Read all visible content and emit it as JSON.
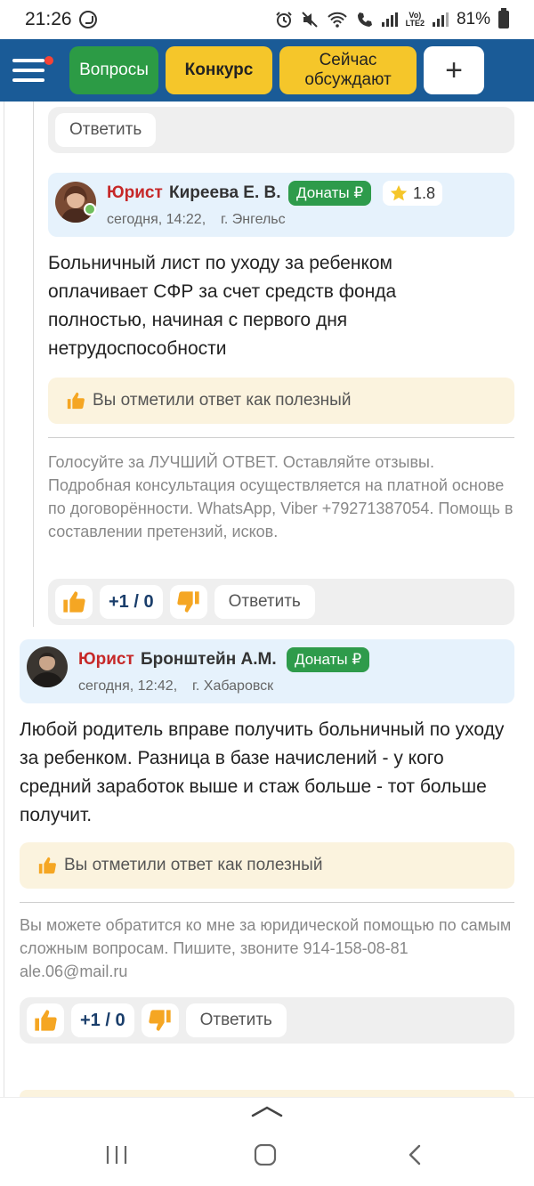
{
  "status_bar": {
    "time": "21:26",
    "battery": "81%",
    "lte": "Vo) LTE2"
  },
  "header": {
    "questions_label": "Вопросы",
    "contest_label": "Конкурс",
    "discussing_label": "Сейчас обсуждают",
    "add_label": "+"
  },
  "prev_post": {
    "reply_label": "Ответить"
  },
  "answer1": {
    "role": "Юрист",
    "name": "Киреева Е. В.",
    "donate_label": "Донаты ₽",
    "rating": "1.8",
    "time": "сегодня, 14:22,",
    "city": "г. Энгельс",
    "text": "Больничный лист по уходу за ребенком оплачивает СФР за счет средств фонда полностью, начиная с первого дня нетрудоспособности",
    "useful_label": "Вы отметили ответ как полезный",
    "signature": "Голосуйте за ЛУЧШИЙ ОТВЕТ. Оставляйте отзывы. Подробная консультация осуществляется на платной основе по договорённости. WhatsApp, Viber +79271387054. Помощь в составлении претензий, исков.",
    "score": "+1 / 0",
    "reply_label": "Ответить"
  },
  "answer2": {
    "role": "Юрист",
    "name": "Бронштейн А.М.",
    "donate_label": "Донаты ₽",
    "time": "сегодня, 12:42,",
    "city": "г. Хабаровск",
    "text": "Любой родитель вправе получить больничный по уходу за ребенком. Разница в базе начислений - у кого средний заработок выше и стаж больше - тот больше получит.",
    "useful_label": "Вы отметили ответ как полезный",
    "signature": "Вы можете обратится ко мне за юридической помощью по самым сложным вопросам. Пишите, звоните 914-158-08-81 ale.06@mail.ru",
    "score": "+1 / 0",
    "reply_label": "Ответить"
  },
  "colors": {
    "header_bg": "#1a5b97",
    "questions_btn": "#2c9b45",
    "contest_btn": "#f5c62a",
    "role_red": "#c62828",
    "donate_green": "#2e9b4b",
    "thumb_orange": "#f5a623"
  },
  "icons": [
    "whatsapp-icon",
    "alarm-icon",
    "mute-icon",
    "wifi-icon",
    "call-icon",
    "signal-icon",
    "battery-icon",
    "menu-icon",
    "star-icon",
    "thumbs-up-icon",
    "thumbs-down-icon",
    "recents-icon",
    "home-icon",
    "back-icon",
    "chevron-up-icon"
  ]
}
